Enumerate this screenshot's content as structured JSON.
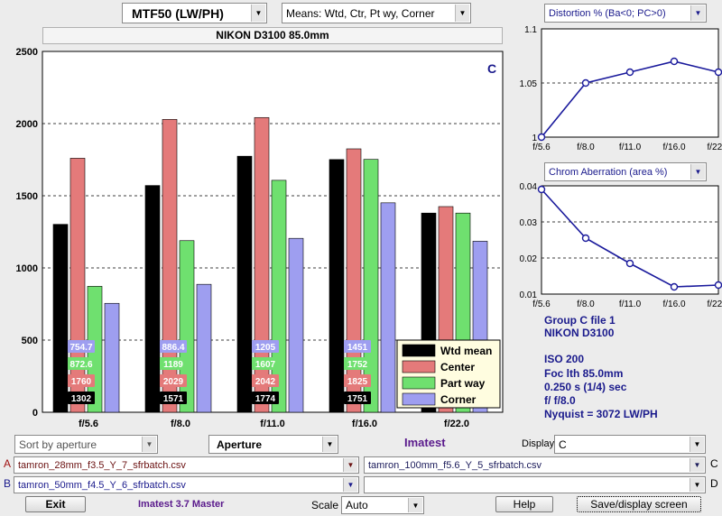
{
  "top": {
    "metric_select": "MTF50 (LW/PH)",
    "means_select": "Means: Wtd, Ctr, Pt wy, Corner",
    "camera_title": "NIKON D3100    85.0mm"
  },
  "chart_data": {
    "type": "bar",
    "corner_label": "C",
    "categories": [
      "f/5.6",
      "f/8.0",
      "f/11.0",
      "f/16.0",
      "f/22.0"
    ],
    "ylim": [
      0,
      2500
    ],
    "yticks": [
      "0",
      "500",
      "1000",
      "1500",
      "2000",
      "2500"
    ],
    "series": [
      {
        "name": "Wtd mean",
        "color": "#000000",
        "values": [
          1302,
          1571,
          1774,
          1751,
          1380
        ]
      },
      {
        "name": "Center",
        "color": "#e47a7a",
        "values": [
          1760,
          2029,
          2042,
          1825,
          1425
        ]
      },
      {
        "name": "Part way",
        "color": "#6fe06f",
        "values": [
          872.6,
          1189,
          1607,
          1752,
          1380
        ]
      },
      {
        "name": "Corner",
        "color": "#9e9ef0",
        "values": [
          754.7,
          886.4,
          1205,
          1451,
          1185
        ]
      }
    ],
    "data_labels": [
      [
        "1302",
        "1760",
        "872.6",
        "754.7"
      ],
      [
        "1571",
        "2029",
        "1189",
        "886.4"
      ],
      [
        "1774",
        "2042",
        "1607",
        "1205"
      ],
      [
        "1751",
        "1825",
        "1752",
        "1451"
      ]
    ],
    "legend": [
      "Wtd mean",
      "Center",
      "Part way",
      "Corner"
    ]
  },
  "distortion": {
    "select": "Distortion %  (Ba<0; PC>0)",
    "type": "line",
    "categories": [
      "f/5.6",
      "f/8.0",
      "f/11.0",
      "f/16.0",
      "f/22.0"
    ],
    "values": [
      1.0,
      1.05,
      1.06,
      1.07,
      1.06
    ],
    "ylim": [
      1.0,
      1.1
    ],
    "yticks": [
      "1",
      "1.05",
      "1.1"
    ]
  },
  "chrom": {
    "select": "Chrom Aberration (area %)",
    "type": "line",
    "categories": [
      "f/5.6",
      "f/8.0",
      "f/11.0",
      "f/16.0",
      "f/22.0"
    ],
    "values": [
      0.039,
      0.0255,
      0.0185,
      0.012,
      0.0125
    ],
    "ylim": [
      0.01,
      0.04
    ],
    "yticks": [
      "0.01",
      "0.02",
      "0.03",
      "0.04"
    ]
  },
  "info": {
    "line1": "Group C file 1",
    "line2": "NIKON D3100",
    "line3": "ISO  200",
    "line4": "Foc lth  85.0mm",
    "line5": "0.250 s  (1/4)  sec",
    "line6": "f/  f/8.0",
    "line7": "Nyquist = 3072 LW/PH"
  },
  "controls": {
    "sort_select": "Sort by aperture",
    "aperture_select": "Aperture",
    "imatest_label": "Imatest",
    "display_label": "Display",
    "display_select": "C",
    "file_a_letter": "A",
    "file_a": "tamron_28mm_f3.5_Y_7_sfrbatch.csv",
    "file_b_letter": "B",
    "file_b": "tamron_50mm_f4.5_Y_6_sfrbatch.csv",
    "file_c_letter": "C",
    "file_c": "tamron_100mm_f5.6_Y_5_sfrbatch.csv",
    "file_d_letter": "D",
    "file_d": "",
    "exit_button": "Exit",
    "version_label": "Imatest 3.7 Master",
    "scale_label": "Scale",
    "scale_select": "Auto",
    "help_button": "Help",
    "save_button": "Save/display screen"
  }
}
